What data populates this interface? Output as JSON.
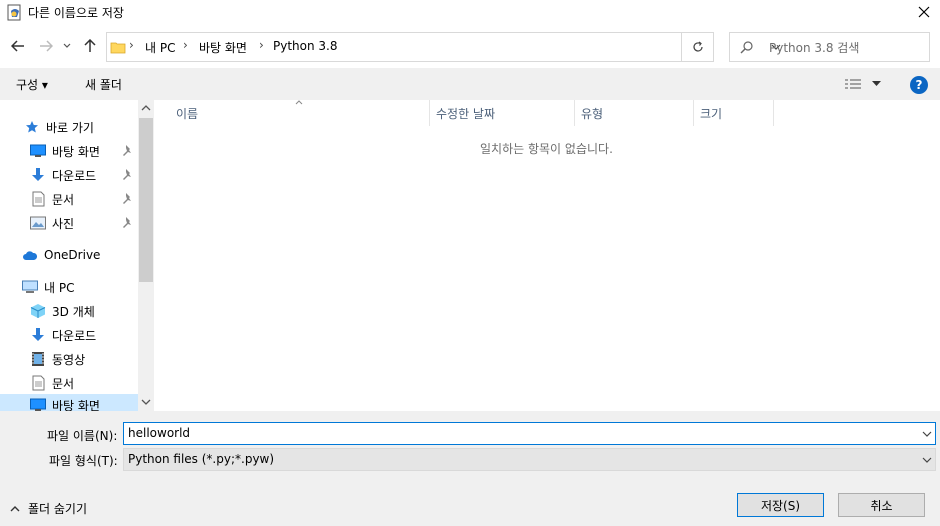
{
  "window": {
    "title": "다른 이름으로 저장"
  },
  "nav": {
    "breadcrumb": [
      "내 PC",
      "바탕 화면",
      "Python 3.8"
    ],
    "search_placeholder": "Python 3.8 검색"
  },
  "toolbar": {
    "organize_label": "구성 ▾",
    "new_folder_label": "새 폴더",
    "help_label": "?"
  },
  "sidebar": {
    "quick_access": "바로 가기",
    "quick_items": [
      {
        "label": "바탕 화면",
        "icon": "desktop-icon"
      },
      {
        "label": "다운로드",
        "icon": "download-icon"
      },
      {
        "label": "문서",
        "icon": "document-icon"
      },
      {
        "label": "사진",
        "icon": "pictures-icon"
      }
    ],
    "onedrive": "OneDrive",
    "this_pc": "내 PC",
    "pc_items": [
      {
        "label": "3D 개체",
        "icon": "3d-objects-icon"
      },
      {
        "label": "다운로드",
        "icon": "download-icon"
      },
      {
        "label": "동영상",
        "icon": "videos-icon"
      },
      {
        "label": "문서",
        "icon": "document-icon"
      },
      {
        "label": "바탕 화면",
        "icon": "desktop-icon"
      }
    ]
  },
  "content": {
    "columns": [
      "이름",
      "수정한 날짜",
      "유형",
      "크기"
    ],
    "empty_message": "일치하는 항목이 없습니다."
  },
  "form": {
    "filename_label": "파일 이름(N):",
    "filename_value": "helloworld",
    "filetype_label": "파일 형식(T):",
    "filetype_value": "Python files (*.py;*.pyw)",
    "save_label": "저장(S)",
    "cancel_label": "취소",
    "hide_folders_label": "폴더 숨기기"
  },
  "colors": {
    "accent": "#0078d7",
    "folder": "#ffd75e",
    "help": "#0b66c3"
  }
}
